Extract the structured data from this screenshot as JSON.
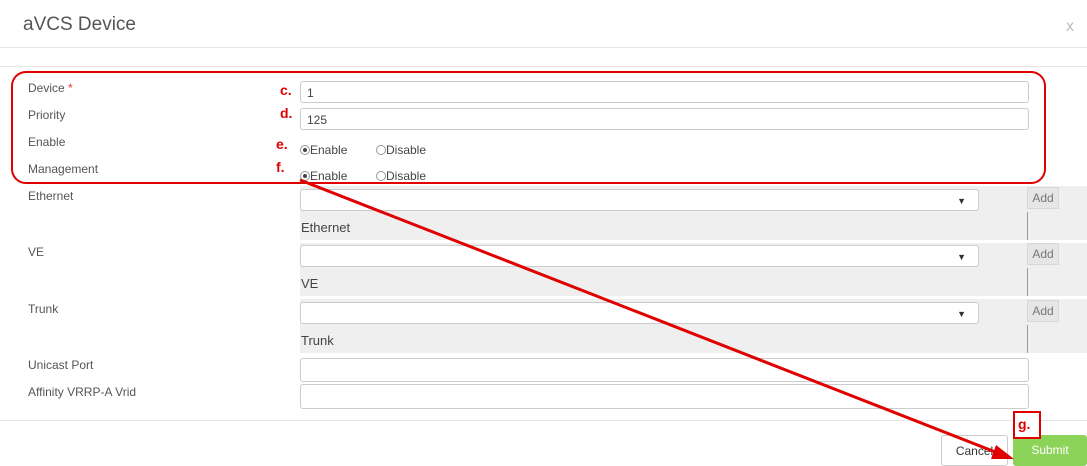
{
  "dialog": {
    "title": "aVCS Device",
    "close_label": "x"
  },
  "fields": {
    "device": {
      "label": "Device",
      "required_mark": "*",
      "value": "1"
    },
    "priority": {
      "label": "Priority",
      "value": "125"
    },
    "enable": {
      "label": "Enable",
      "options": [
        "Enable",
        "Disable"
      ],
      "selected": "Enable"
    },
    "management": {
      "label": "Management",
      "options": [
        "Enable",
        "Disable"
      ],
      "selected": "Enable"
    },
    "ethernet": {
      "label": "Ethernet",
      "subheading": "Ethernet",
      "add_label": "Add"
    },
    "ve": {
      "label": "VE",
      "subheading": "VE",
      "add_label": "Add"
    },
    "trunk": {
      "label": "Trunk",
      "subheading": "Trunk",
      "add_label": "Add"
    },
    "unicast_port": {
      "label": "Unicast Port",
      "value": ""
    },
    "affinity": {
      "label": "Affinity VRRP-A Vrid",
      "value": ""
    }
  },
  "annotations": {
    "c": "c.",
    "d": "d.",
    "e": "e.",
    "f": "f.",
    "g": "g.",
    "color": "#e00000"
  },
  "footer": {
    "cancel_label": "Cancel",
    "submit_label": "Submit",
    "submit_color": "#8cd35a"
  }
}
